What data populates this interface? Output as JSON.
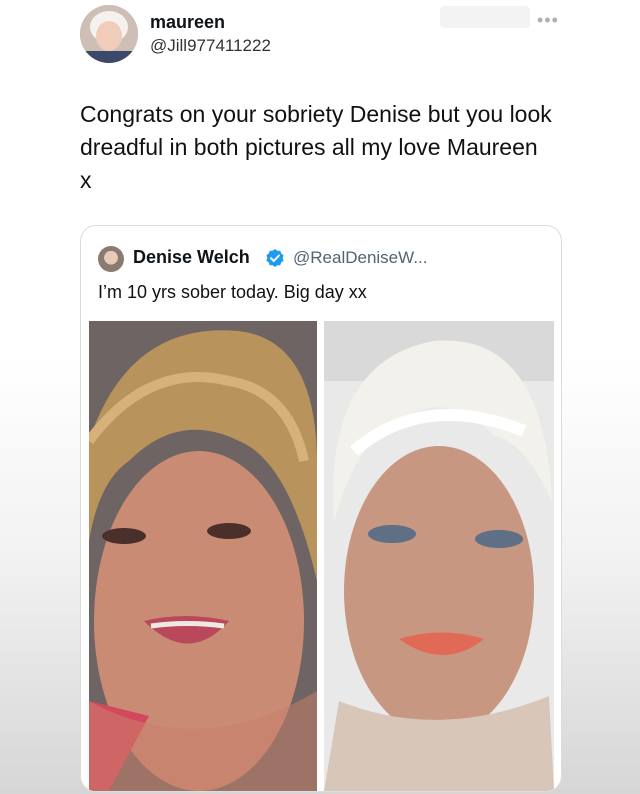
{
  "tweet": {
    "author_name": "maureen",
    "author_handle": "@Jill977411222",
    "more_icon": "more-horizontal-icon",
    "text_line_1": "Congrats on your sobriety Denise but you look",
    "text_line_2": "dreadful in both pictures all my love Maureen",
    "text_line_3": "x"
  },
  "quoted_tweet": {
    "author_name": "Denise Welch",
    "verified_icon": "verified-badge-icon",
    "author_handle": "@RealDeniseW...",
    "text": "I’m 10 yrs sober today. Big day xx",
    "images": [
      "photo-before",
      "photo-after"
    ]
  },
  "colors": {
    "verified_blue": "#1d9bf0",
    "secondary_text": "#536471"
  }
}
